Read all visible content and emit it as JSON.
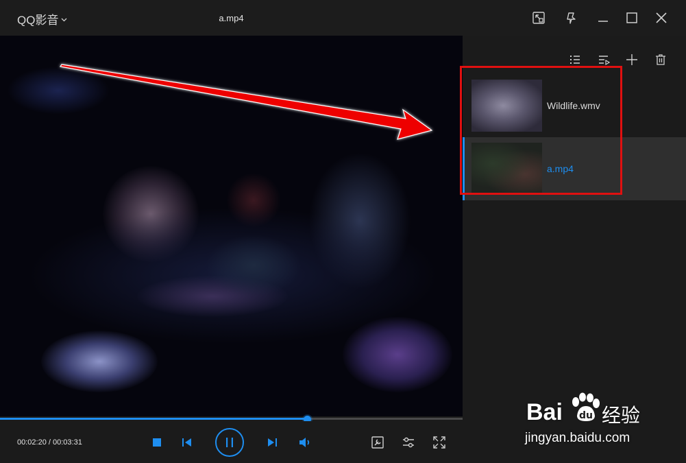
{
  "titlebar": {
    "app_name": "QQ影音",
    "file_title": "a.mp4"
  },
  "icons": {
    "app_menu_caret": "chevron-down-icon",
    "mini_mode": "mini-mode-icon",
    "pin": "pin-icon",
    "minimize": "minimize-icon",
    "maximize": "maximize-icon",
    "close": "close-icon"
  },
  "player": {
    "current_time": "00:02:20",
    "total_time": "00:03:31",
    "time_display": "00:02:20 / 00:03:31",
    "progress_fraction": 0.663
  },
  "playlist": {
    "items": [
      {
        "name": "Wildlife.wmv",
        "active": false
      },
      {
        "name": "a.mp4",
        "active": true
      }
    ]
  },
  "watermark": {
    "brand_left": "Bai",
    "brand_right": "经验",
    "url": "jingyan.baidu.com"
  },
  "colors": {
    "accent": "#1e8ef0",
    "background": "#1b1b1b",
    "annotation": "#e01010"
  }
}
